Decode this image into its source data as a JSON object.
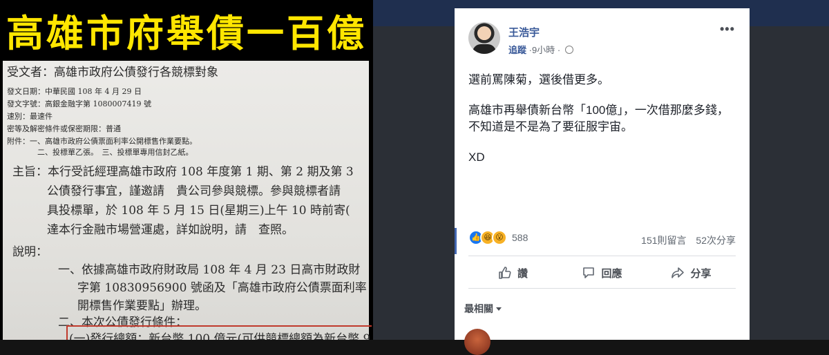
{
  "image_post": {
    "headline": "高雄市府舉債一百億",
    "document_lines": {
      "recipient": "受文者：高雄市政府公債發行各競標對象",
      "date": "發文日期：中華民國 108 年 4 月 29 日",
      "number": "發文字號：高銀金融字第 1080007419 號",
      "speed": "速別：最速件",
      "secrecy": "密等及解密條件或保密期限：普通",
      "attach1": "附件：一、高雄市政府公債票面利率公開標售作業要點。",
      "attach2": "二、投標單乙張。　三、投標單專用信封乙紙。",
      "subject1": "主旨：本行受託經理高雄市政府 108 年度第 1 期、第 2 期及第 3",
      "subject2": "公債發行事宜，謹邀請　貴公司參與競標。參與競標者請",
      "subject3": "具投標單，於 108 年 5 月 15 日(星期三)上午 10 時前寄(",
      "subject4": "達本行金融市場營運處，詳如說明，請　查照。",
      "explain": "說明：",
      "item1a": "一、依據高雄市政府財政局 108 年 4 月 23 日高市財政財",
      "item1b": "字第 10830956900 號函及「高雄市政府公債票面利率",
      "item1c": "開標售作業要點」辦理。",
      "item2": "二、本次公債發行條件：",
      "item2a": "(一)發行總額：新台幣 100 億元(可供競標總額為新台幣 9"
    }
  },
  "post": {
    "author": "王浩宇",
    "follow": "追蹤",
    "time": "9小時",
    "separator": "·",
    "more": "•••",
    "text": {
      "p1": "選前罵陳菊，選後借更多。",
      "p2": "高雄市再舉債新台幣「100億」，一次借那麼多錢，不知道是不是為了要征服宇宙。",
      "p3": "XD"
    },
    "reactions": {
      "count": "588",
      "icons": [
        "like-icon",
        "haha-icon",
        "wow-icon"
      ]
    },
    "comments_count": "151則留言",
    "shares_count": "52次分享",
    "actions": {
      "like": "讚",
      "comment": "回應",
      "share": "分享"
    },
    "sort_label": "最相關"
  },
  "colors": {
    "link": "#385898",
    "headline": "#ffe600",
    "topbar": "#1f2f4f"
  }
}
